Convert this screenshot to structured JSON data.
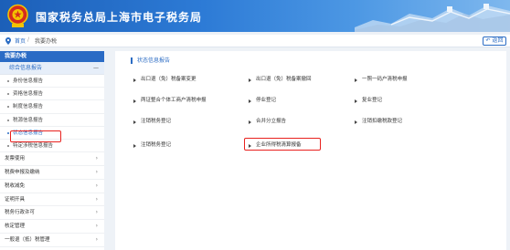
{
  "header": {
    "title": "国家税务总局上海市电子税务局"
  },
  "breadcrumb": {
    "home": "首页",
    "separator": "/",
    "current": "我要办税",
    "back_label": "返回"
  },
  "sidebar": {
    "section_title": "我要办税",
    "group_title": "综合信息报告",
    "group_toggle": "—",
    "children": [
      {
        "label": "身份信息报告"
      },
      {
        "label": "资格信息报告"
      },
      {
        "label": "制度信息报告"
      },
      {
        "label": "税源信息报告"
      },
      {
        "label": "状态信息报告"
      },
      {
        "label": "特定涉税信息报告"
      }
    ],
    "items": [
      {
        "label": "发票使用"
      },
      {
        "label": "税费申报及缴纳"
      },
      {
        "label": "税收减免"
      },
      {
        "label": "证明开具"
      },
      {
        "label": "税务行政许可"
      },
      {
        "label": "核定管理"
      },
      {
        "label": "一般退（抵）税管理"
      }
    ],
    "chevron": "›"
  },
  "panel": {
    "title": "状态信息报告",
    "links": [
      {
        "label": "出口退（免）税备案变更"
      },
      {
        "label": "出口退（免）税备案撤回"
      },
      {
        "label": "一照一码户清税申报"
      },
      {
        "label": "两证整合个体工商户清税申报"
      },
      {
        "label": "停业登记"
      },
      {
        "label": "复业登记"
      },
      {
        "label": "注销税务登记"
      },
      {
        "label": "合并分立报告"
      },
      {
        "label": "注销扣缴税款登记"
      },
      {
        "label": "注销税务登记"
      },
      {
        "label": "企业所得税清算报备"
      }
    ]
  },
  "colors": {
    "accent": "#2b6cc4",
    "highlight": "#e8211e",
    "header_start": "#1c5fb8"
  }
}
